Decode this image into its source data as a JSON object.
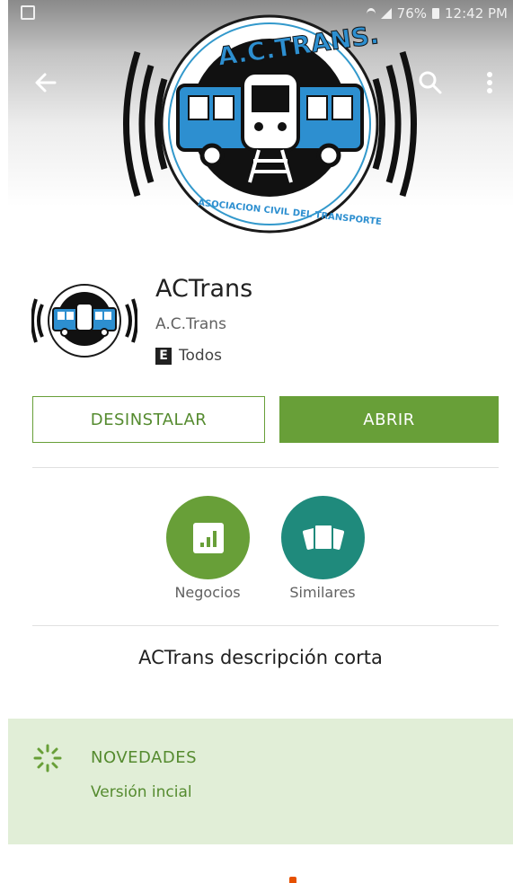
{
  "statusbar": {
    "battery": "76%",
    "time": "12:42 PM"
  },
  "toolbar": {
    "back_icon": "arrow-back-icon",
    "search_icon": "search-icon",
    "menu_icon": "more-vert-icon"
  },
  "hero": {
    "logo_top_text": "A.C.TRANS.",
    "logo_bottom_text": "ASOCIACION CIVIL DEL TRANSPORTE"
  },
  "app": {
    "title": "ACTrans",
    "developer": "A.C.Trans",
    "rating_badge": "E",
    "rating_text": "Todos"
  },
  "buttons": {
    "uninstall_label": "DESINSTALAR",
    "open_label": "ABRIR"
  },
  "badges": [
    {
      "label": "Negocios",
      "icon": "bar-chart-icon",
      "color": "#689f38"
    },
    {
      "label": "Similares",
      "icon": "cards-icon",
      "color": "#1f8a7c"
    }
  ],
  "short_description": "ACTrans descripción corta",
  "whats_new": {
    "title": "NOVEDADES",
    "text": "Versión incial",
    "icon": "sparkle-icon",
    "background": "#e1eed7"
  },
  "colors": {
    "accent": "#689f38",
    "accent_text": "#558b2f"
  }
}
